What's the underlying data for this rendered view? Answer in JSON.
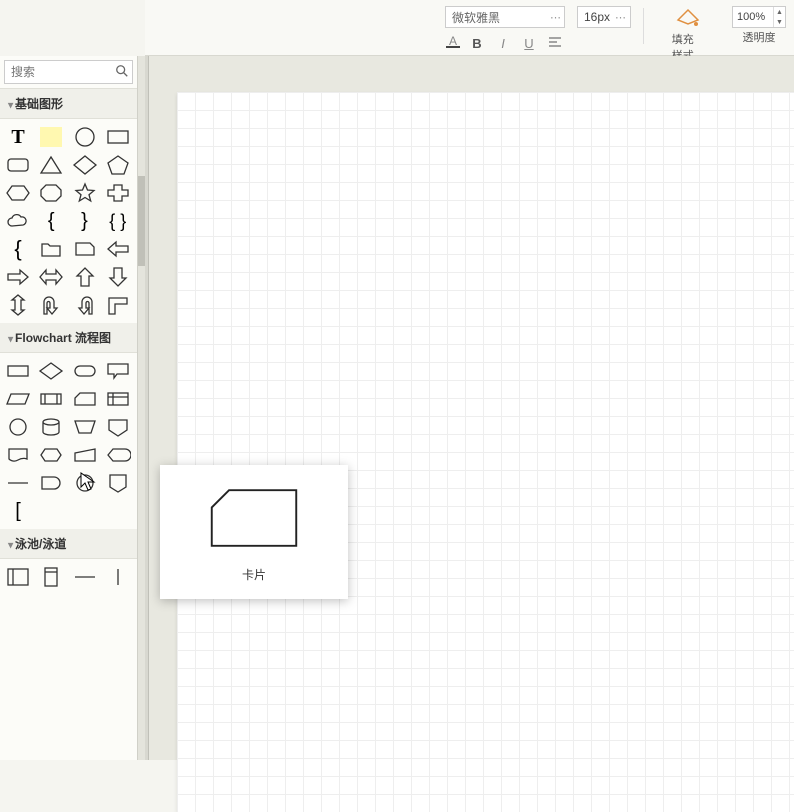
{
  "toolbar": {
    "font_name": "微软雅黑",
    "font_size": "16px",
    "zoom": "100%",
    "fill_label": "填充样式",
    "opacity_label": "透明度"
  },
  "search": {
    "placeholder": "搜索"
  },
  "sections": {
    "basic": "基础图形",
    "flowchart": "Flowchart 流程图",
    "swimlane": "泳池/泳道"
  },
  "tooltip": {
    "label": "卡片"
  }
}
